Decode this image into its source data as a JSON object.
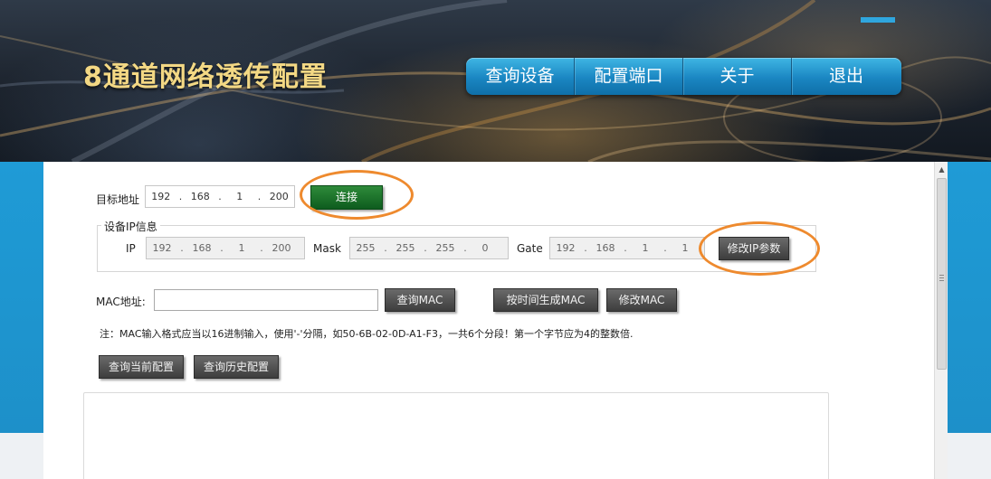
{
  "header": {
    "title": "8通道网络透传配置",
    "nav": [
      "查询设备",
      "配置端口",
      "关于",
      "退出"
    ],
    "accent_color": "#2fa6de",
    "title_color": "#f3d884"
  },
  "target": {
    "label": "目标地址",
    "ip": [
      "192",
      "168",
      "1",
      "200"
    ],
    "connect_label": "连接"
  },
  "device_ip": {
    "legend": "设备IP信息",
    "ip_label": "IP",
    "ip": [
      "192",
      "168",
      "1",
      "200"
    ],
    "mask_label": "Mask",
    "mask": [
      "255",
      "255",
      "255",
      "0"
    ],
    "gate_label": "Gate",
    "gate": [
      "192",
      "168",
      "1",
      "1"
    ],
    "modify_label": "修改IP参数"
  },
  "mac": {
    "label": "MAC地址:",
    "value": "",
    "query_label": "查询MAC",
    "gen_label": "按时间生成MAC",
    "modify_label": "修改MAC"
  },
  "note": "注：MAC输入格式应当以16进制输入，使用'-'分隔，如50-6B-02-0D-A1-F3，一共6个分段！第一个字节应为4的整数倍.",
  "query_buttons": {
    "current": "查询当前配置",
    "history": "查询历史配置"
  },
  "output_text": "",
  "annotation_color": "#ee8a2e",
  "icons": {
    "scroll_up": "▲",
    "scroll_grip": "grip-lines-icon"
  }
}
